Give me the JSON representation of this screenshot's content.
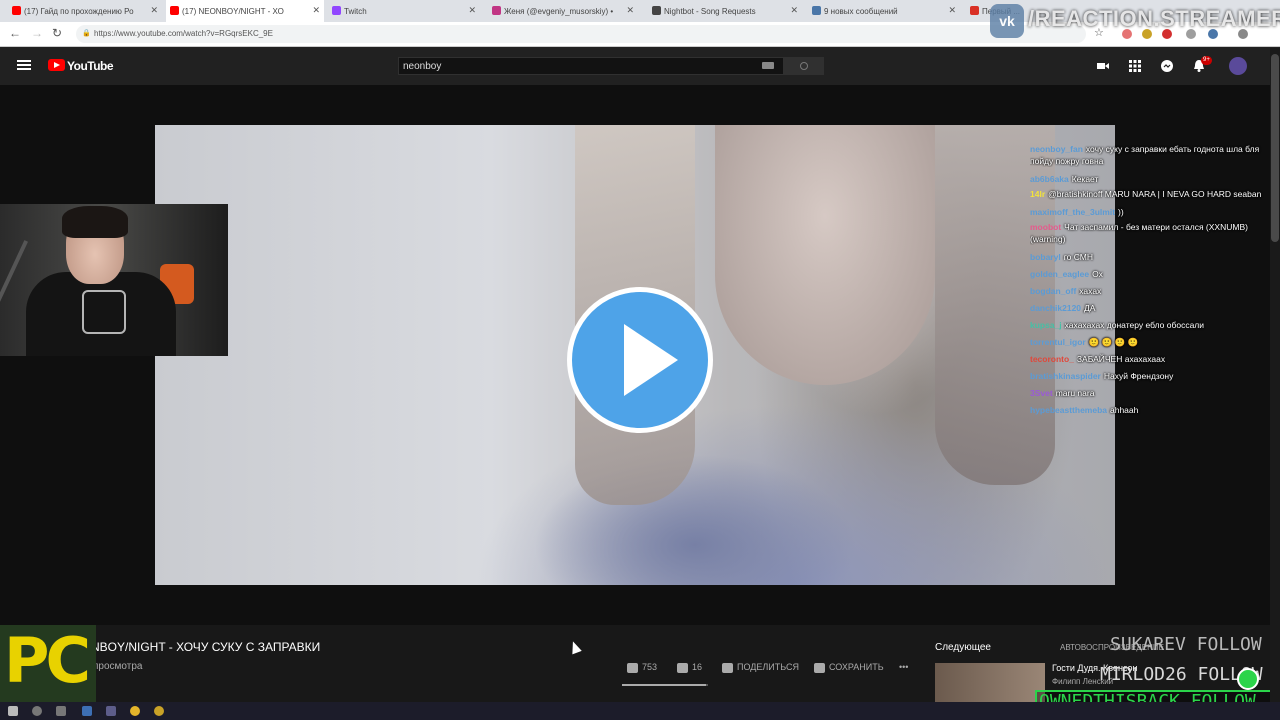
{
  "browser": {
    "tabs": [
      {
        "label": "(17) Гайд по прохождению Ро",
        "favicon_color": "#ff0000",
        "active": false
      },
      {
        "label": "(17) NEONBOY/NIGHT - ХО",
        "favicon_color": "#ff0000",
        "active": true
      },
      {
        "label": "Twitch",
        "favicon_color": "#9146ff",
        "active": false
      },
      {
        "label": "Женя (@evgeniy_musorskiy) •",
        "favicon_color": "#c13584",
        "active": false
      },
      {
        "label": "Nightbot - Song Requests",
        "favicon_color": "#444444",
        "active": false
      },
      {
        "label": "9 новых сообщений",
        "favicon_color": "#4a76a8",
        "active": false
      },
      {
        "label": "Первый ...",
        "favicon_color": "#d93025",
        "active": false
      }
    ],
    "url": "https://www.youtube.com/watch?v=RGqrsEKC_9E"
  },
  "youtube": {
    "logo_text": "YouTube",
    "search_value": "neonboy",
    "notification_count": "9+"
  },
  "video": {
    "title": "NEONBOY/NIGHT - ХОЧУ СУКУ С ЗАПРАВКИ",
    "views": "просмотра",
    "likes": "753",
    "dislikes": "16",
    "like_ratio": 0.979,
    "share_label": "ПОДЕЛИТЬСЯ",
    "save_label": "СОХРАНИТЬ",
    "more_label": "•••"
  },
  "sidebar": {
    "up_next_label": "Следующее",
    "autoplay_label": "АВТОВОСПРОИЗВЕДЕНИЕ",
    "next_video_title": "Гости Дудя. Квенсон",
    "next_video_channel": "Филипп Ленский"
  },
  "chat": {
    "messages": [
      {
        "user": "neonboy_fan",
        "color": "#5b9bd5",
        "text": "хочу суку с заправки ебать годнота шла бля пойду пожру говна"
      },
      {
        "user": "ab6b6aka",
        "color": "#5b9bd5",
        "text": "Кекает"
      },
      {
        "user": "14lr",
        "color": "#f3e33b",
        "text": "@bratishkinoff MARU NARA | I NEVA GO HARD seaban"
      },
      {
        "user": "maximoff_the_3ulmit",
        "color": "#5b9bd5",
        "text": "))"
      },
      {
        "user": "moobot",
        "color": "#e65a8c",
        "text": "Чат заспамил - без матери остался (XXNUMB) (warning)"
      },
      {
        "user": "bobaryl",
        "color": "#5b9bd5",
        "text": "го СМН"
      },
      {
        "user": "golden_eaglee",
        "color": "#5b9bd5",
        "text": "Ох"
      },
      {
        "user": "bogdan_off",
        "color": "#5b9bd5",
        "text": "хахах"
      },
      {
        "user": "danchik2120",
        "color": "#5b9bd5",
        "text": "ДА"
      },
      {
        "user": "kupsa_j",
        "color": "#45c0a5",
        "text": "хахахахах донатеру ебло обоссали"
      },
      {
        "user": "torrentul_igor",
        "color": "#5b9bd5",
        "text": "🙂 🙂 🙂 🙂"
      },
      {
        "user": "tecoronto_",
        "color": "#e0483b",
        "text": "ЗАБАЙЧЕН ахахахаах"
      },
      {
        "user": "bratishkinaspider",
        "color": "#5b9bd5",
        "text": "Нахуй Френдзону"
      },
      {
        "user": "3Svet",
        "color": "#9b59d6",
        "text": "maru nara"
      },
      {
        "user": "hypebeastthemeba",
        "color": "#5b9bd5",
        "text": "ahhaah"
      }
    ]
  },
  "overlay": {
    "watermark": "/REACTION.STREAMERS",
    "pc_logo": "PC",
    "followers": [
      {
        "text": "SUKAREV FOLLOW",
        "color": "#b8b8b8"
      },
      {
        "text": "MIRLOD26 FOLLOW",
        "color": "#d8d8d8"
      },
      {
        "text": "OWNEDTHISBACK FOLLOW",
        "color": "#2bd44a"
      }
    ]
  }
}
